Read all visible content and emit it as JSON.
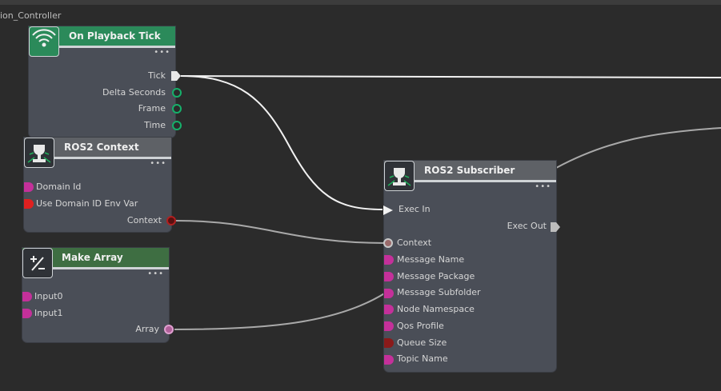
{
  "graph": {
    "title": "ion_Controller"
  },
  "nodes": {
    "playback": {
      "title": "On Playback Tick",
      "more": "•••",
      "outputs": [
        "Tick",
        "Delta Seconds",
        "Frame",
        "Time"
      ]
    },
    "context": {
      "title": "ROS2 Context",
      "more": "•••",
      "inputs": [
        "Domain Id",
        "Use Domain ID Env Var"
      ],
      "outputs": [
        "Context"
      ]
    },
    "make_array": {
      "title": "Make Array",
      "more": "•••",
      "inputs": [
        "Input0",
        "Input1"
      ],
      "outputs": [
        "Array"
      ]
    },
    "subscriber": {
      "title": "ROS2 Subscriber",
      "more": "•••",
      "exec_in": "Exec In",
      "exec_out": "Exec Out",
      "inputs": [
        "Context",
        "Message Name",
        "Message Package",
        "Message Subfolder",
        "Node Namespace",
        "Qos Profile",
        "Queue Size",
        "Topic Name"
      ]
    }
  },
  "colors": {
    "exec_pin": "#e8e8e8",
    "bundle_pin": "#16b06a",
    "uint_pin": "#c4309a",
    "bool_pin": "#e02020",
    "context_pin": "#8a1a1a",
    "array_pin": "#d08ac0",
    "header_green": "#2b8a5a",
    "header_gray": "#5e6166",
    "header_dark_green": "#3e6e42"
  }
}
